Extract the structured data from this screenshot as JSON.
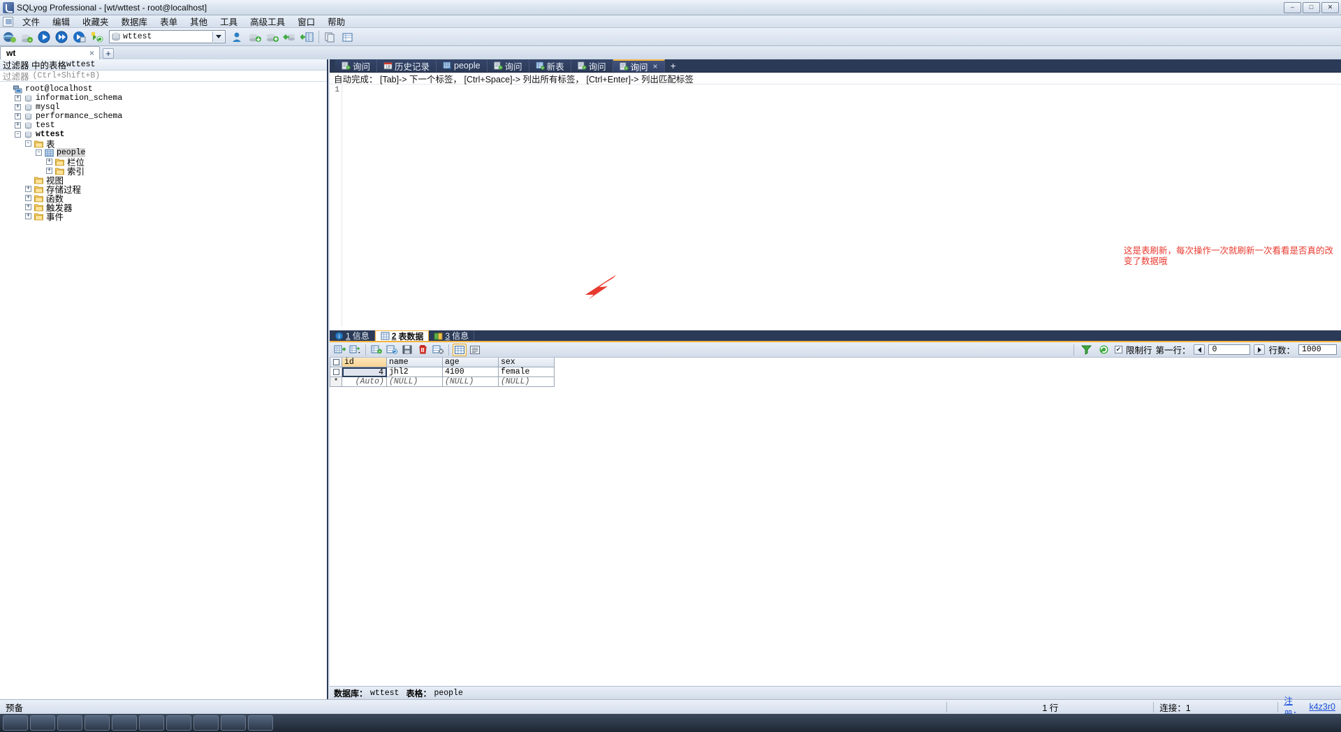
{
  "window": {
    "title": "SQLyog Professional - [wt/wttest - root@localhost]",
    "min_label": "–",
    "max_label": "□",
    "close_label": "✕"
  },
  "mdi": {
    "min": "–",
    "restore": "□",
    "close": "✕"
  },
  "menu": {
    "items": [
      "文件",
      "编辑",
      "收藏夹",
      "数据库",
      "表单",
      "其他",
      "工具",
      "高级工具",
      "窗口",
      "帮助"
    ]
  },
  "toolbar": {
    "db_selected": "wttest",
    "icons": [
      "new-connection-icon",
      "add-database-icon",
      "execute-query-icon",
      "execute-all-icon",
      "execute-current-icon",
      "refresh-objects-icon"
    ],
    "icons_right": [
      "user-manager-icon",
      "backup-database-icon",
      "restore-database-icon",
      "import-data-icon",
      "export-table-icon",
      "schema-designer-icon"
    ]
  },
  "connection_tabs": {
    "tabs": [
      {
        "label": "wt",
        "close": "×",
        "active": true
      }
    ],
    "add_label": "+"
  },
  "object_browser": {
    "filter_title_prefix": "过滤器 中的表格",
    "filter_title_db": "wttest",
    "filter_placeholder_cjk": "过滤器",
    "filter_placeholder_key": "(Ctrl+Shift+B)",
    "tree": [
      {
        "label": "root@localhost",
        "indent": 0,
        "toggle": "none",
        "icon": "host-icon",
        "bold": false,
        "mono": true
      },
      {
        "label": "information_schema",
        "indent": 1,
        "toggle": "+",
        "icon": "database-icon",
        "bold": false,
        "mono": true
      },
      {
        "label": "mysql",
        "indent": 1,
        "toggle": "+",
        "icon": "database-icon",
        "bold": false,
        "mono": true
      },
      {
        "label": "performance_schema",
        "indent": 1,
        "toggle": "+",
        "icon": "database-icon",
        "bold": false,
        "mono": true
      },
      {
        "label": "test",
        "indent": 1,
        "toggle": "+",
        "icon": "database-icon",
        "bold": false,
        "mono": true
      },
      {
        "label": "wttest",
        "indent": 1,
        "toggle": "-",
        "icon": "database-icon",
        "bold": true,
        "mono": true
      },
      {
        "label": "表",
        "indent": 2,
        "toggle": "-",
        "icon": "folder-icon",
        "bold": false,
        "mono": false
      },
      {
        "label": "people",
        "indent": 3,
        "toggle": "-",
        "icon": "table-icon",
        "bold": false,
        "mono": true,
        "selected": true
      },
      {
        "label": "栏位",
        "indent": 4,
        "toggle": "+",
        "icon": "folder-icon",
        "bold": false,
        "mono": false
      },
      {
        "label": "索引",
        "indent": 4,
        "toggle": "+",
        "icon": "folder-icon",
        "bold": false,
        "mono": false
      },
      {
        "label": "视图",
        "indent": 2,
        "toggle": "none",
        "icon": "folder-icon",
        "bold": false,
        "mono": false
      },
      {
        "label": "存储过程",
        "indent": 2,
        "toggle": "+",
        "icon": "folder-icon",
        "bold": false,
        "mono": false
      },
      {
        "label": "函数",
        "indent": 2,
        "toggle": "+",
        "icon": "folder-icon",
        "bold": false,
        "mono": false
      },
      {
        "label": "触发器",
        "indent": 2,
        "toggle": "+",
        "icon": "folder-icon",
        "bold": false,
        "mono": false
      },
      {
        "label": "事件",
        "indent": 2,
        "toggle": "+",
        "icon": "folder-icon",
        "bold": false,
        "mono": false
      }
    ]
  },
  "query_tabs": {
    "tabs": [
      {
        "label": "询问",
        "icon": "query-icon",
        "active": false
      },
      {
        "label": "历史记录",
        "icon": "history-icon",
        "active": false
      },
      {
        "label": "people",
        "icon": "table-icon",
        "active": false
      },
      {
        "label": "询问",
        "icon": "query-icon",
        "active": false
      },
      {
        "label": "新表",
        "icon": "newtable-icon",
        "active": false
      },
      {
        "label": "询问",
        "icon": "query-icon",
        "active": false
      },
      {
        "label": "询问",
        "icon": "query-icon",
        "active": true,
        "close": "×"
      }
    ],
    "add_label": "+"
  },
  "editor": {
    "autocomplete_hint": "自动完成： [Tab]-> 下一个标签， [Ctrl+Space]-> 列出所有标签， [Ctrl+Enter]-> 列出匹配标签",
    "line_number": "1",
    "content": ""
  },
  "annotation": {
    "text": "这是表刷新，每次操作一次就刷新一次看看是否真的改变了数据哦",
    "color": "#e8392e"
  },
  "result_tabs": {
    "tabs": [
      {
        "num": "1",
        "label": "信息",
        "icon": "info-icon",
        "active": false
      },
      {
        "num": "2",
        "label": "表数据",
        "icon": "griddata-icon",
        "active": true
      },
      {
        "num": "3",
        "label": "信息",
        "icon": "detail-icon",
        "active": false
      }
    ]
  },
  "result_toolbar": {
    "icons": [
      "insert-row-icon",
      "insert-dropdown-icon",
      "duplicate-row-icon",
      "refresh-row-icon",
      "save-changes-icon",
      "delete-row-icon",
      "cancel-changes-icon",
      "grid-view-icon",
      "form-view-icon"
    ],
    "filter_icon": "filter-icon",
    "refresh_icon": "refresh-icon",
    "limit_checked": true,
    "limit_label": "限制行",
    "first_row_label": "第一行：",
    "first_row_value": "0",
    "rowcount_label": "行数：",
    "rowcount_value": "1000"
  },
  "grid": {
    "columns": [
      "id",
      "name",
      "age",
      "sex"
    ],
    "primary_key": "id",
    "rows": [
      {
        "id": "4",
        "name": "jhl2",
        "age": "4100",
        "sex": "female"
      }
    ],
    "new_row": {
      "marker": "*",
      "id": "(Auto)",
      "name": "(NULL)",
      "age": "(NULL)",
      "sex": "(NULL)"
    }
  },
  "db_info": {
    "database_label": "数据库：",
    "database_value": "wttest",
    "table_label": "表格：",
    "table_value": "people"
  },
  "status_bar": {
    "left": "预备",
    "rows": "1 行",
    "connection": "连接：1",
    "session_label": "注册：",
    "session_value": "k4z3r0"
  }
}
